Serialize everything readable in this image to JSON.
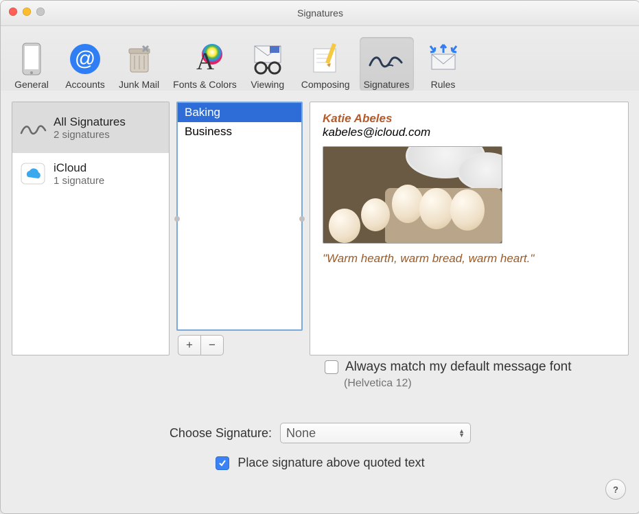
{
  "window": {
    "title": "Signatures"
  },
  "toolbar": {
    "items": [
      {
        "label": "General"
      },
      {
        "label": "Accounts"
      },
      {
        "label": "Junk Mail"
      },
      {
        "label": "Fonts & Colors"
      },
      {
        "label": "Viewing"
      },
      {
        "label": "Composing"
      },
      {
        "label": "Signatures"
      },
      {
        "label": "Rules"
      }
    ],
    "active_index": 6
  },
  "accounts_pane": {
    "items": [
      {
        "title": "All Signatures",
        "subtitle": "2 signatures",
        "icon": "signature-icon",
        "selected": true
      },
      {
        "title": "iCloud",
        "subtitle": "1 signature",
        "icon": "icloud-icon",
        "selected": false
      }
    ]
  },
  "signatures_list": {
    "items": [
      {
        "name": "Baking",
        "selected": true
      },
      {
        "name": "Business",
        "selected": false
      }
    ]
  },
  "buttons": {
    "add": "+",
    "remove": "−"
  },
  "preview": {
    "name": "Katie Abeles",
    "email": "kabeles@icloud.com",
    "quote": "\"Warm hearth, warm bread, warm heart.\"",
    "colors": {
      "accent": "#b55a29",
      "quote": "#9a5a25"
    }
  },
  "options": {
    "match_font_label": "Always match my default message font",
    "match_font_sub": "(Helvetica 12)",
    "match_font_checked": false,
    "choose_label": "Choose Signature:",
    "choose_value": "None",
    "place_above_label": "Place signature above quoted text",
    "place_above_checked": true
  },
  "help_label": "?"
}
